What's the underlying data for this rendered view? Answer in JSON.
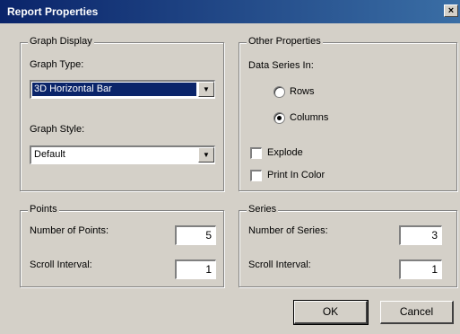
{
  "window": {
    "title": "Report Properties",
    "close_glyph": "×"
  },
  "graph_display": {
    "title": "Graph Display",
    "graph_type_label": "Graph Type:",
    "graph_type_value": "3D Horizontal Bar",
    "graph_style_label": "Graph Style:",
    "graph_style_value": "Default"
  },
  "other_properties": {
    "title": "Other Properties",
    "data_series_label": "Data Series In:",
    "rows_label": "Rows",
    "columns_label": "Columns",
    "selected": "Columns",
    "explode_label": "Explode",
    "print_color_label": "Print In Color"
  },
  "points": {
    "title": "Points",
    "number_label": "Number of Points:",
    "number_value": "5",
    "scroll_label": "Scroll Interval:",
    "scroll_value": "1"
  },
  "series": {
    "title": "Series",
    "number_label": "Number of Series:",
    "number_value": "3",
    "scroll_label": "Scroll Interval:",
    "scroll_value": "1"
  },
  "buttons": {
    "ok": "OK",
    "cancel": "Cancel"
  },
  "icons": {
    "dropdown": "chevron-down-icon",
    "close": "close-icon"
  }
}
